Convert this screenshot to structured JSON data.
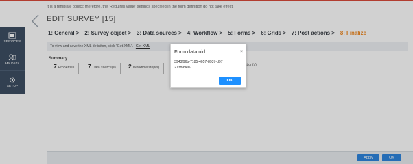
{
  "notice": "It is a template object; therefore, the 'Requires value' settings specified in the form definition do not take effect.",
  "sidebar": {
    "items": [
      {
        "label": "SERVICES",
        "icon": "services-icon"
      },
      {
        "label": "MY DATA",
        "icon": "my-data-icon"
      },
      {
        "label": "SETUP",
        "icon": "setup-icon"
      }
    ]
  },
  "header": {
    "title": "EDIT SURVEY [15]",
    "back_icon": "chevron-left-icon"
  },
  "steps": [
    {
      "label": "1: General >"
    },
    {
      "label": "2: Survey object >"
    },
    {
      "label": "3: Data sources >"
    },
    {
      "label": "4: Workflow >"
    },
    {
      "label": "5: Forms >"
    },
    {
      "label": "6: Grids >"
    },
    {
      "label": "7: Post actions >"
    },
    {
      "label": "8: Finalize"
    }
  ],
  "hint": {
    "text": "To view and save the XML definiton, click \"Get XML\".",
    "link": "Get XML"
  },
  "summary": {
    "title": "Summary",
    "items": [
      {
        "num": "7",
        "text": "Properties"
      },
      {
        "num": "7",
        "text": "Data source(s)"
      },
      {
        "num": "2",
        "text": "Workflow step(s)"
      },
      {
        "num": "",
        "text": "action(s)"
      }
    ]
  },
  "footer": {
    "apply_label": "Apply",
    "ok_label": "OK"
  },
  "modal": {
    "title": "Form data uid",
    "close_symbol": "×",
    "uid": "3943f96b-7185-4057-8937-d97273b99ed7",
    "ok_label": "OK"
  },
  "colors": {
    "active_step": "#f08a24",
    "sidebar_bg": "#3d4f63",
    "primary_button": "#1e90ff",
    "top_border": "#d94b3b"
  }
}
